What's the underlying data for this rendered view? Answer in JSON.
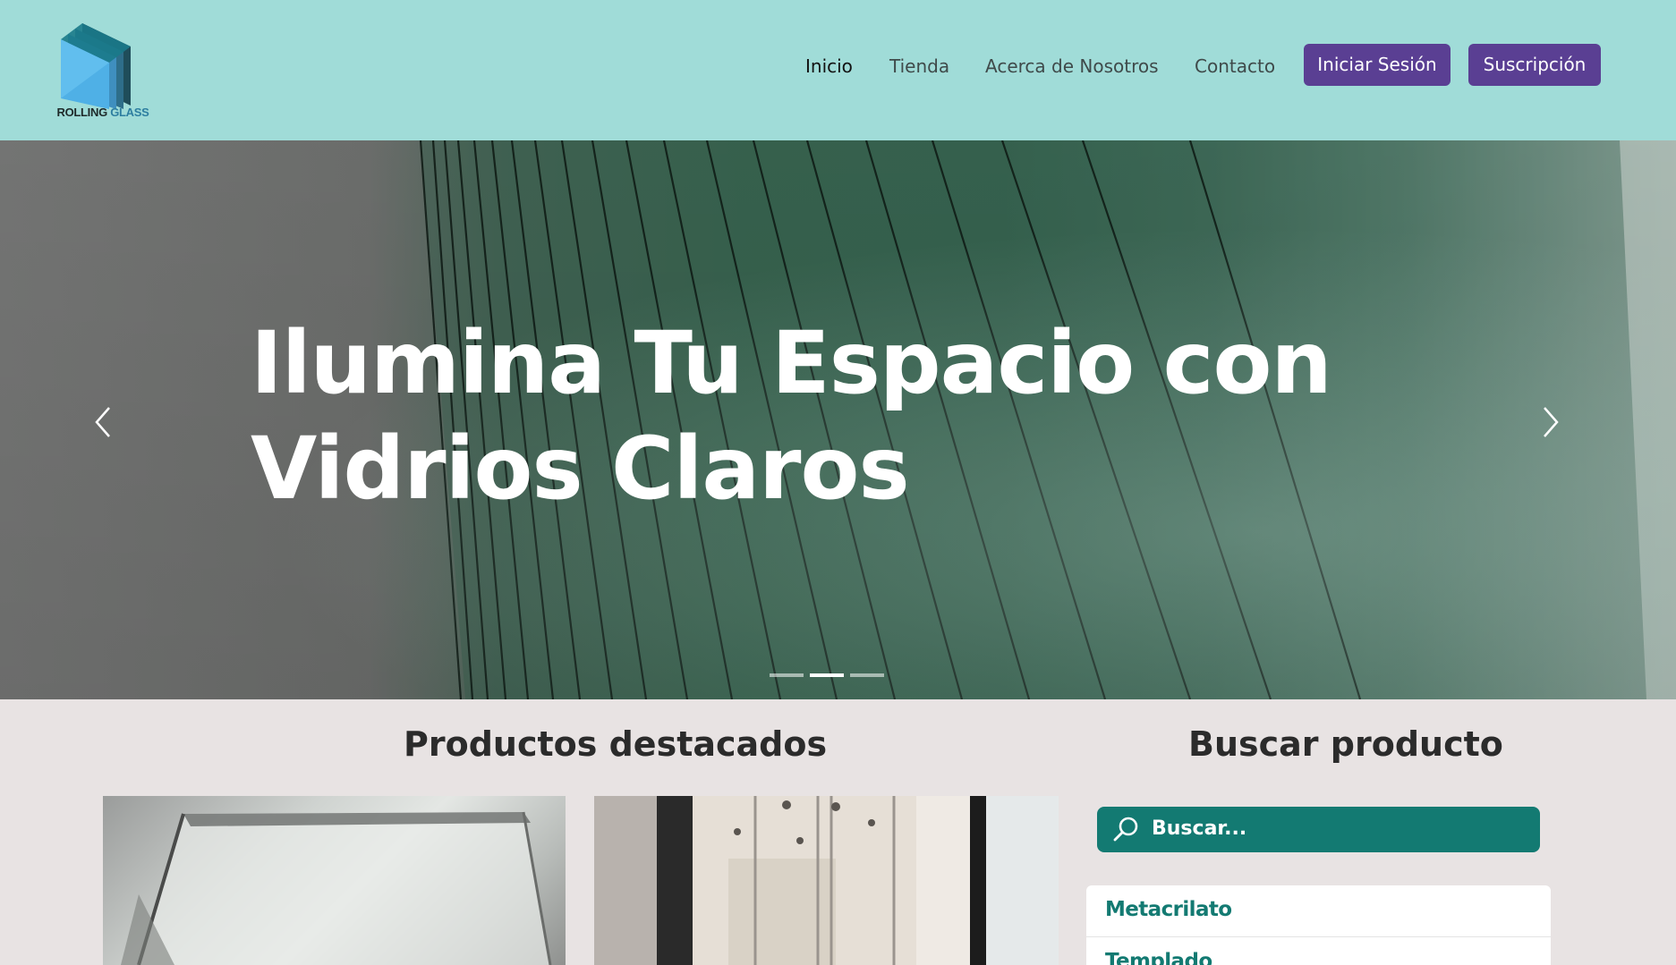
{
  "brand": {
    "logo_word_1": "ROLLING",
    "logo_word_2": "GLASS",
    "colors": {
      "header_bg": "#a0dcd8",
      "button_bg": "#5a3f93",
      "accent": "#137a72"
    }
  },
  "nav": {
    "links": [
      "Inicio",
      "Tienda",
      "Acerca de Nosotros",
      "Contacto"
    ],
    "active": "Inicio",
    "login_label": "Iniciar Sesión",
    "subscribe_label": "Suscripción"
  },
  "hero": {
    "title_line_1": "Ilumina Tu Espacio con",
    "title_line_2": "Vidrios Claros",
    "prev_icon": "chevron-left-icon",
    "next_icon": "chevron-right-icon",
    "slide_count": 3,
    "active_slide": 2
  },
  "featured": {
    "title": "Productos destacados"
  },
  "search": {
    "title": "Buscar producto",
    "placeholder": "Buscar...",
    "icon": "search-icon",
    "categories": [
      "Metacrilato",
      "Templado"
    ]
  }
}
